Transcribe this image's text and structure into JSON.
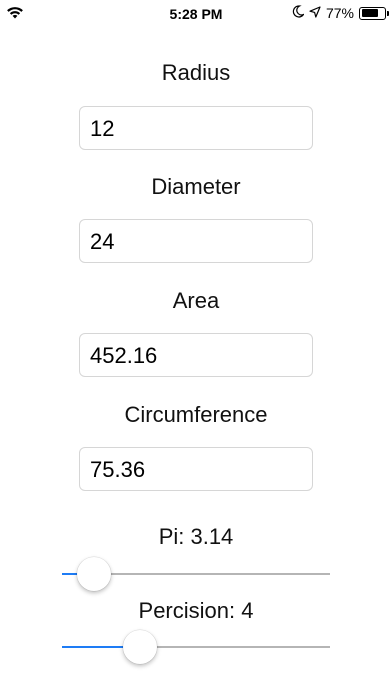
{
  "status_bar": {
    "time": "5:28 PM",
    "battery_percent": "77%",
    "battery_level": 0.77,
    "icons": [
      "wifi-icon",
      "moon-icon",
      "location-icon",
      "battery-icon"
    ]
  },
  "form": {
    "radius": {
      "label": "Radius",
      "value": "12"
    },
    "diameter": {
      "label": "Diameter",
      "value": "24"
    },
    "area": {
      "label": "Area",
      "value": "452.16"
    },
    "circumference": {
      "label": "Circumference",
      "value": "75.36"
    }
  },
  "sliders": {
    "pi": {
      "label": "Pi: 3.14",
      "position": 0.12
    },
    "precision": {
      "label": "Percision: 4",
      "position": 0.29
    }
  },
  "colors": {
    "slider_active": "#1e7cf5",
    "slider_inactive": "#b5b5b5",
    "field_border": "#d6d6d6"
  }
}
